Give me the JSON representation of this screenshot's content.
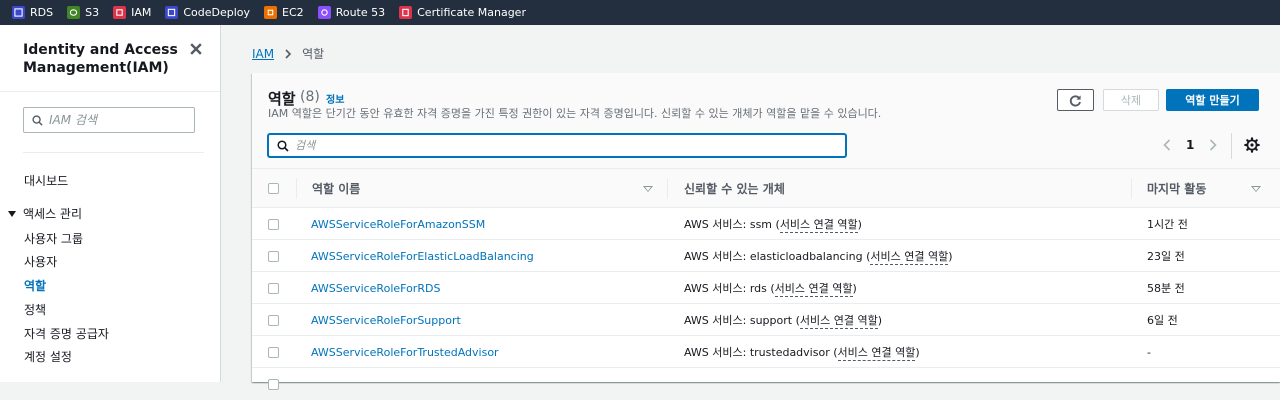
{
  "favorites": [
    {
      "label": "RDS",
      "color": "#3b48cc"
    },
    {
      "label": "S3",
      "color": "#3f8624"
    },
    {
      "label": "IAM",
      "color": "#dd344c"
    },
    {
      "label": "CodeDeploy",
      "color": "#3b48cc"
    },
    {
      "label": "EC2",
      "color": "#ed7100"
    },
    {
      "label": "Route 53",
      "color": "#8c4fff"
    },
    {
      "label": "Certificate Manager",
      "color": "#dd344c"
    }
  ],
  "sidenav": {
    "title": "Identity and Access Management(IAM)",
    "search_placeholder": "IAM 검색",
    "dashboard": "대시보드",
    "section": "액세스 관리",
    "items": [
      "사용자 그룹",
      "사용자",
      "역할",
      "정책",
      "자격 증명 공급자",
      "계정 설정"
    ],
    "active_item": "역할"
  },
  "breadcrumb": {
    "root": "IAM",
    "current": "역할"
  },
  "header": {
    "title": "역할",
    "count": "(8)",
    "info": "정보",
    "description": "IAM 역할은 단기간 동안 유효한 자격 증명을 가진 특정 권한이 있는 자격 증명입니다. 신뢰할 수 있는 개체가 역할을 맡을 수 있습니다.",
    "delete_label": "삭제",
    "create_label": "역할 만들기",
    "search_placeholder": "검색",
    "page": "1"
  },
  "table": {
    "columns": [
      "역할 이름",
      "신뢰할 수 있는 개체",
      "마지막 활동"
    ],
    "rows": [
      {
        "name": "AWSServiceRoleForAmazonSSM",
        "entity_prefix": "AWS 서비스: ssm (",
        "entity_link": "서비스 연결 역할",
        "entity_suffix": ")",
        "last": "1시간 전"
      },
      {
        "name": "AWSServiceRoleForElasticLoadBalancing",
        "entity_prefix": "AWS 서비스: elasticloadbalancing (",
        "entity_link": "서비스 연결 역할",
        "entity_suffix": ")",
        "last": "23일 전"
      },
      {
        "name": "AWSServiceRoleForRDS",
        "entity_prefix": "AWS 서비스: rds (",
        "entity_link": "서비스 연결 역할",
        "entity_suffix": ")",
        "last": "58분 전"
      },
      {
        "name": "AWSServiceRoleForSupport",
        "entity_prefix": "AWS 서비스: support (",
        "entity_link": "서비스 연결 역할",
        "entity_suffix": ")",
        "last": "6일 전"
      },
      {
        "name": "AWSServiceRoleForTrustedAdvisor",
        "entity_prefix": "AWS 서비스: trustedadvisor (",
        "entity_link": "서비스 연결 역할",
        "entity_suffix": ")",
        "last": "-"
      }
    ]
  }
}
